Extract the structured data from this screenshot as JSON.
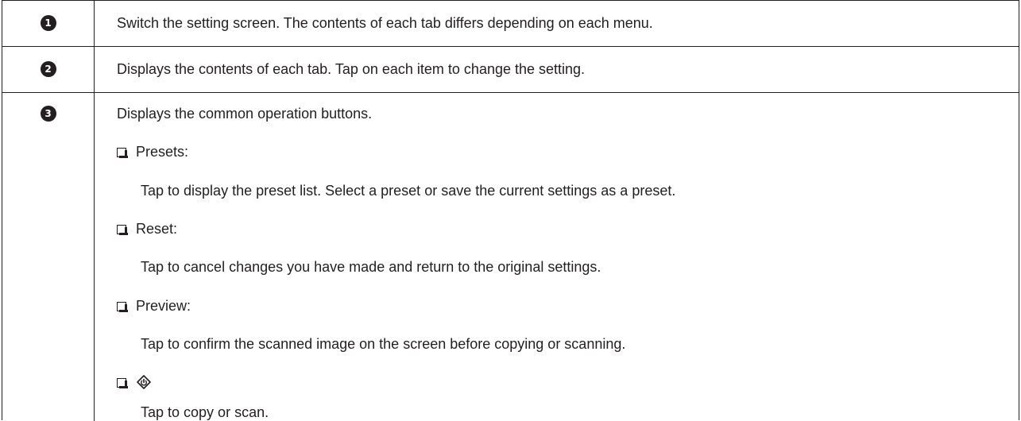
{
  "rows": [
    {
      "number": "1",
      "text": "Switch the setting screen. The contents of each tab differs depending on each menu."
    },
    {
      "number": "2",
      "text": "Displays the contents of each tab. Tap on each item to change the setting."
    },
    {
      "number": "3",
      "intro": "Displays the common operation buttons.",
      "items": [
        {
          "label": "Presets:",
          "description": "Tap to display the preset list. Select a preset or save the current settings as a preset."
        },
        {
          "label": "Reset:",
          "description": "Tap to cancel changes you have made and return to the original settings."
        },
        {
          "label": "Preview:",
          "description": "Tap to confirm the scanned image on the screen before copying or scanning."
        },
        {
          "icon": "start-icon",
          "description": "Tap to copy or scan."
        }
      ]
    }
  ]
}
